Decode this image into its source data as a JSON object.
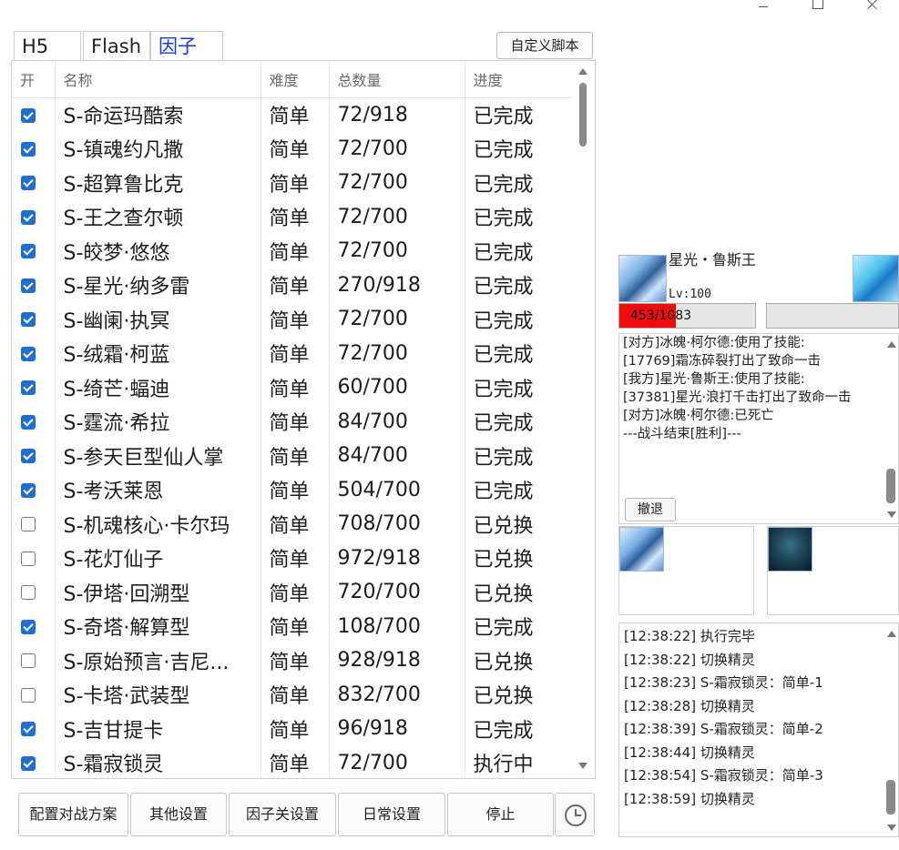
{
  "tabs": [
    {
      "label": "H5",
      "active": false
    },
    {
      "label": "Flash",
      "active": false
    },
    {
      "label": "因子",
      "active": true
    }
  ],
  "custom_script_label": "自定义脚本",
  "table": {
    "headers": [
      "开",
      "名称",
      "难度",
      "总数量",
      "进度"
    ],
    "rows": [
      {
        "checked": true,
        "name": "S-命运玛酷索",
        "difficulty": "简单",
        "count": "72/918",
        "progress": "已完成"
      },
      {
        "checked": true,
        "name": "S-镇魂约凡撒",
        "difficulty": "简单",
        "count": "72/700",
        "progress": "已完成"
      },
      {
        "checked": true,
        "name": "S-超算鲁比克",
        "difficulty": "简单",
        "count": "72/700",
        "progress": "已完成"
      },
      {
        "checked": true,
        "name": "S-王之查尔顿",
        "difficulty": "简单",
        "count": "72/700",
        "progress": "已完成"
      },
      {
        "checked": true,
        "name": "S-皎梦·悠悠",
        "difficulty": "简单",
        "count": "72/700",
        "progress": "已完成"
      },
      {
        "checked": true,
        "name": "S-星光·纳多雷",
        "difficulty": "简单",
        "count": "270/918",
        "progress": "已完成"
      },
      {
        "checked": true,
        "name": "S-幽阑·执冥",
        "difficulty": "简单",
        "count": "72/700",
        "progress": "已完成"
      },
      {
        "checked": true,
        "name": "S-绒霜·柯蓝",
        "difficulty": "简单",
        "count": "72/700",
        "progress": "已完成"
      },
      {
        "checked": true,
        "name": "S-绮芒·蝠迪",
        "difficulty": "简单",
        "count": "60/700",
        "progress": "已完成"
      },
      {
        "checked": true,
        "name": "S-霆流·希拉",
        "difficulty": "简单",
        "count": "84/700",
        "progress": "已完成"
      },
      {
        "checked": true,
        "name": "S-参天巨型仙人掌",
        "difficulty": "简单",
        "count": "84/700",
        "progress": "已完成"
      },
      {
        "checked": true,
        "name": "S-考沃莱恩",
        "difficulty": "简单",
        "count": "504/700",
        "progress": "已完成"
      },
      {
        "checked": false,
        "name": "S-机魂核心·卡尔玛",
        "difficulty": "简单",
        "count": "708/700",
        "progress": "已兑换"
      },
      {
        "checked": false,
        "name": "S-花灯仙子",
        "difficulty": "简单",
        "count": "972/918",
        "progress": "已兑换"
      },
      {
        "checked": false,
        "name": "S-伊塔·回溯型",
        "difficulty": "简单",
        "count": "720/700",
        "progress": "已兑换"
      },
      {
        "checked": true,
        "name": "S-奇塔·解算型",
        "difficulty": "简单",
        "count": "108/700",
        "progress": "已完成"
      },
      {
        "checked": false,
        "name": "S-原始预言·吉尼...",
        "difficulty": "简单",
        "count": "928/918",
        "progress": "已兑换"
      },
      {
        "checked": false,
        "name": "S-卡塔·武装型",
        "difficulty": "简单",
        "count": "832/700",
        "progress": "已兑换"
      },
      {
        "checked": true,
        "name": "S-吉甘提卡",
        "difficulty": "简单",
        "count": "96/918",
        "progress": "已完成"
      },
      {
        "checked": true,
        "name": "S-霜寂锁灵",
        "difficulty": "简单",
        "count": "72/700",
        "progress": "执行中"
      }
    ]
  },
  "bottom_buttons": [
    "配置对战方案",
    "其他设置",
    "因子关设置",
    "日常设置",
    "停止"
  ],
  "clock_icon": "clock-icon",
  "battle": {
    "pet_name": "星光・鲁斯王",
    "level": "Lv:100",
    "hp": "453/1083",
    "hp_current": 453,
    "hp_max": 1083,
    "hp_color": "#ee0d0d",
    "log": [
      "[对方]冰魄·柯尔德:使用了技能:",
      "[17769]霜冻碎裂打出了致命一击",
      "[我方]星光·鲁斯王:使用了技能:",
      "[37381]星光·浪打千击打出了致命一击",
      "[对方]冰魄·柯尔德:已死亡",
      "---战斗结束[胜利]---"
    ],
    "retreat_label": "撤退"
  },
  "run_log": [
    "[12:38:22]  执行完毕",
    "[12:38:22] 切换精灵",
    "[12:38:23] S-霜寂锁灵：简单-1",
    "[12:38:28] 切换精灵",
    "[12:38:39] S-霜寂锁灵：简单-2",
    "[12:38:44] 切换精灵",
    "[12:38:54] S-霜寂锁灵：简单-3",
    "[12:38:59] 切换精灵"
  ]
}
